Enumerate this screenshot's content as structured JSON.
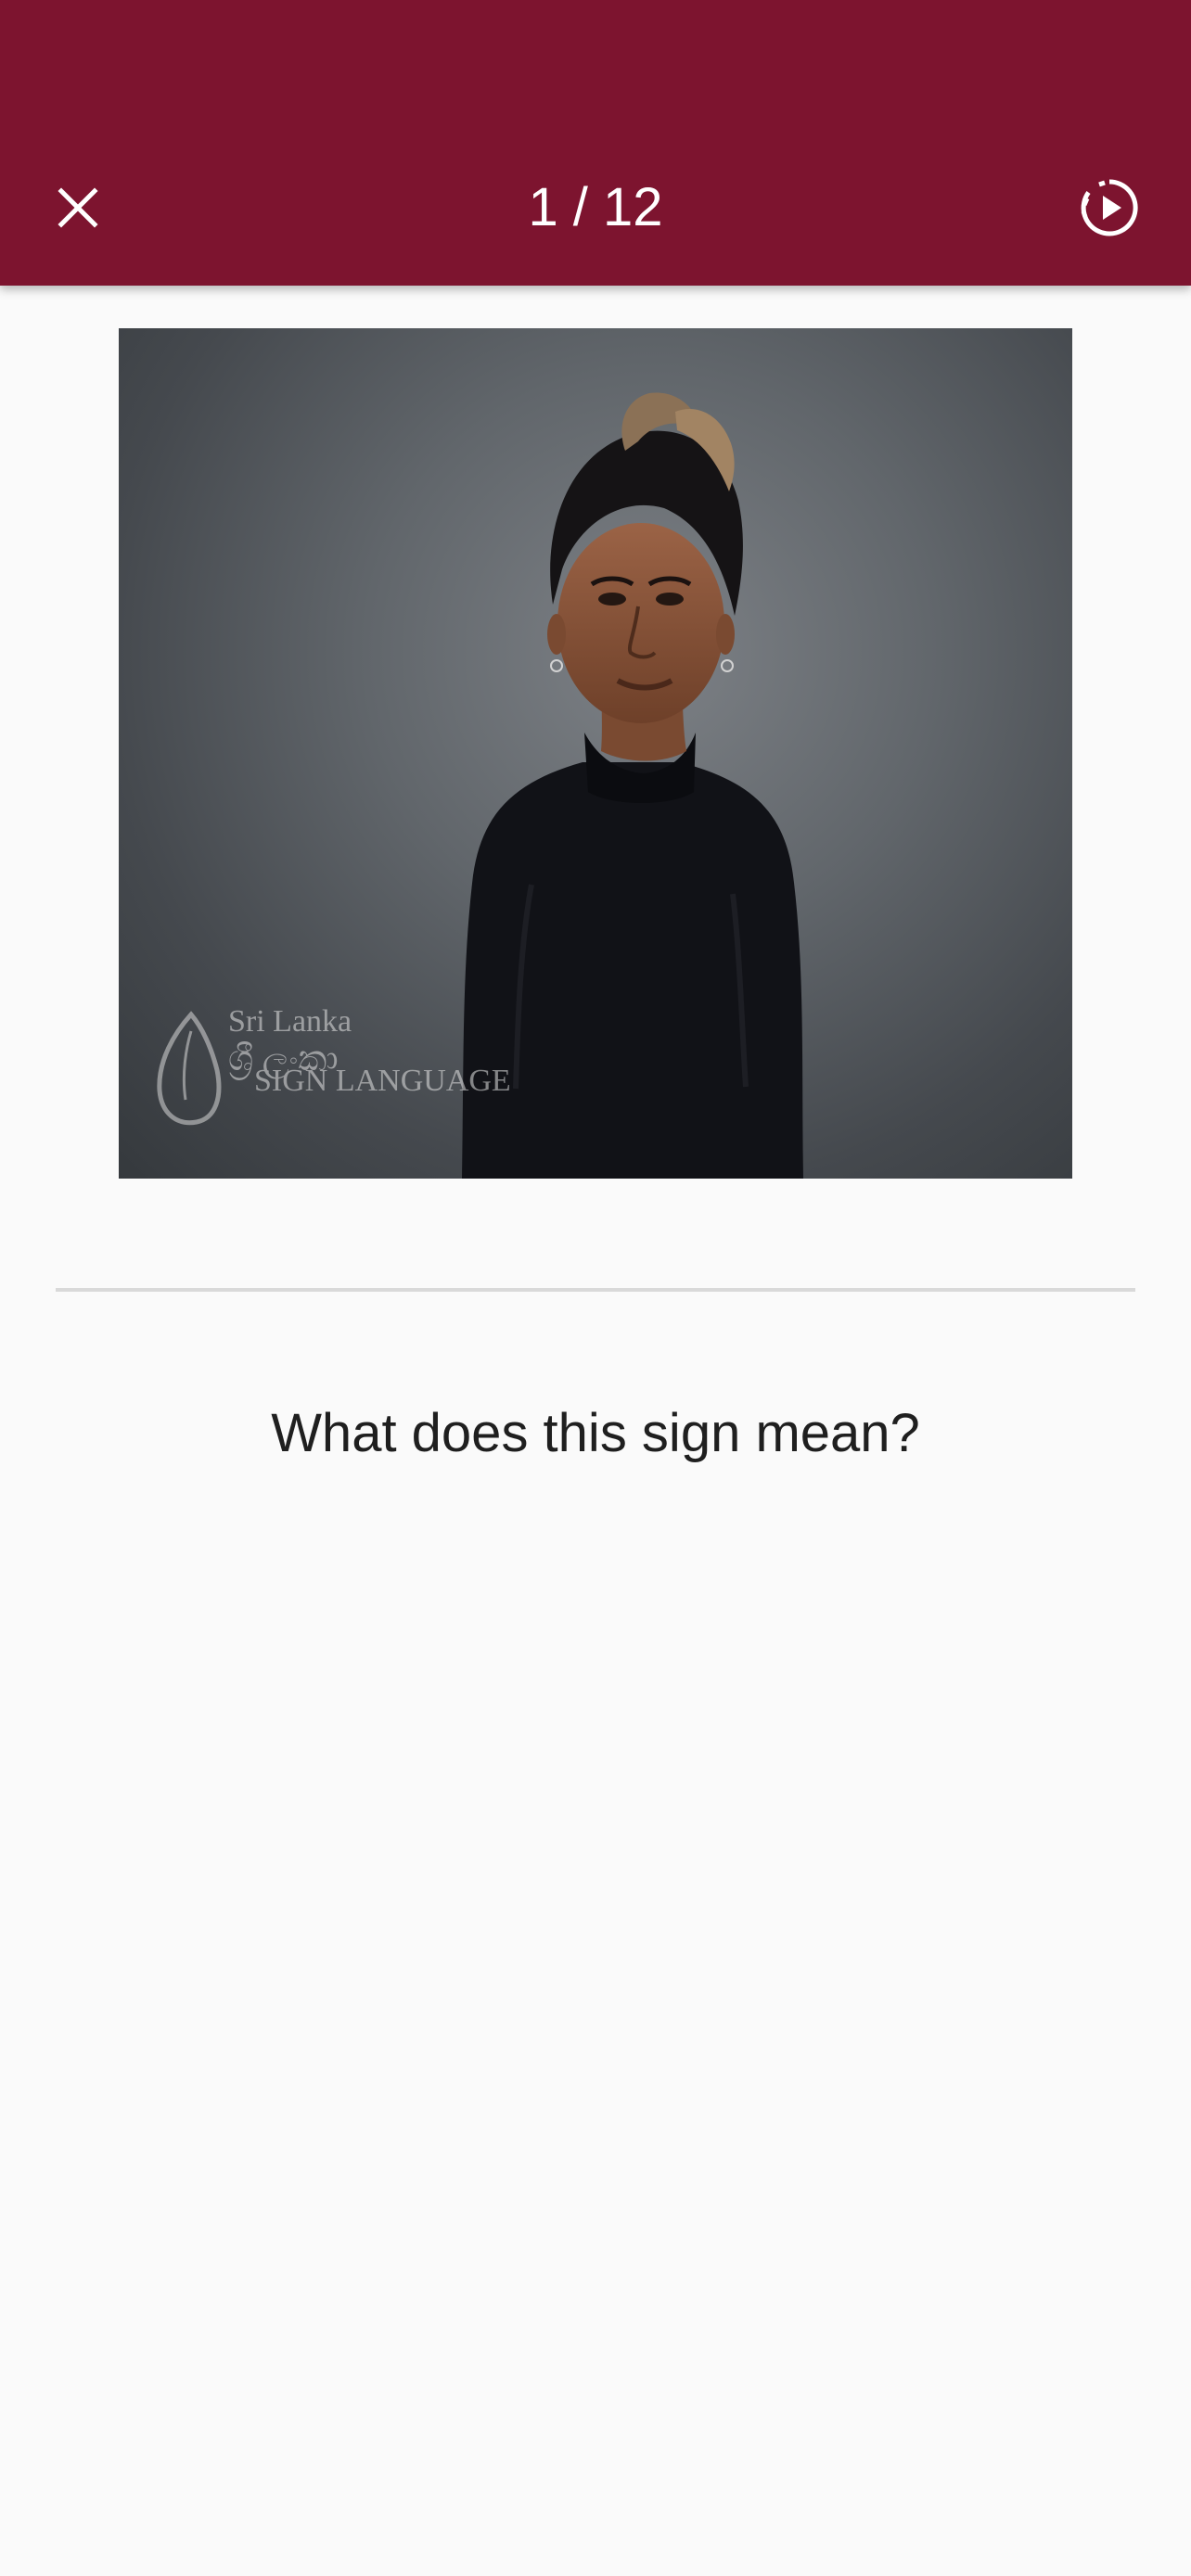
{
  "header": {
    "progress": "1 / 12",
    "close_icon": "close-icon",
    "autoplay_icon": "autoplay-circle-icon",
    "background": "#7d142f"
  },
  "video": {
    "watermark_line1": "Sri Lanka",
    "watermark_script": "ශ්‍රී ලංකා",
    "watermark_line2": "SIGN LANGUAGE"
  },
  "question": {
    "text": "What does this sign mean?"
  }
}
